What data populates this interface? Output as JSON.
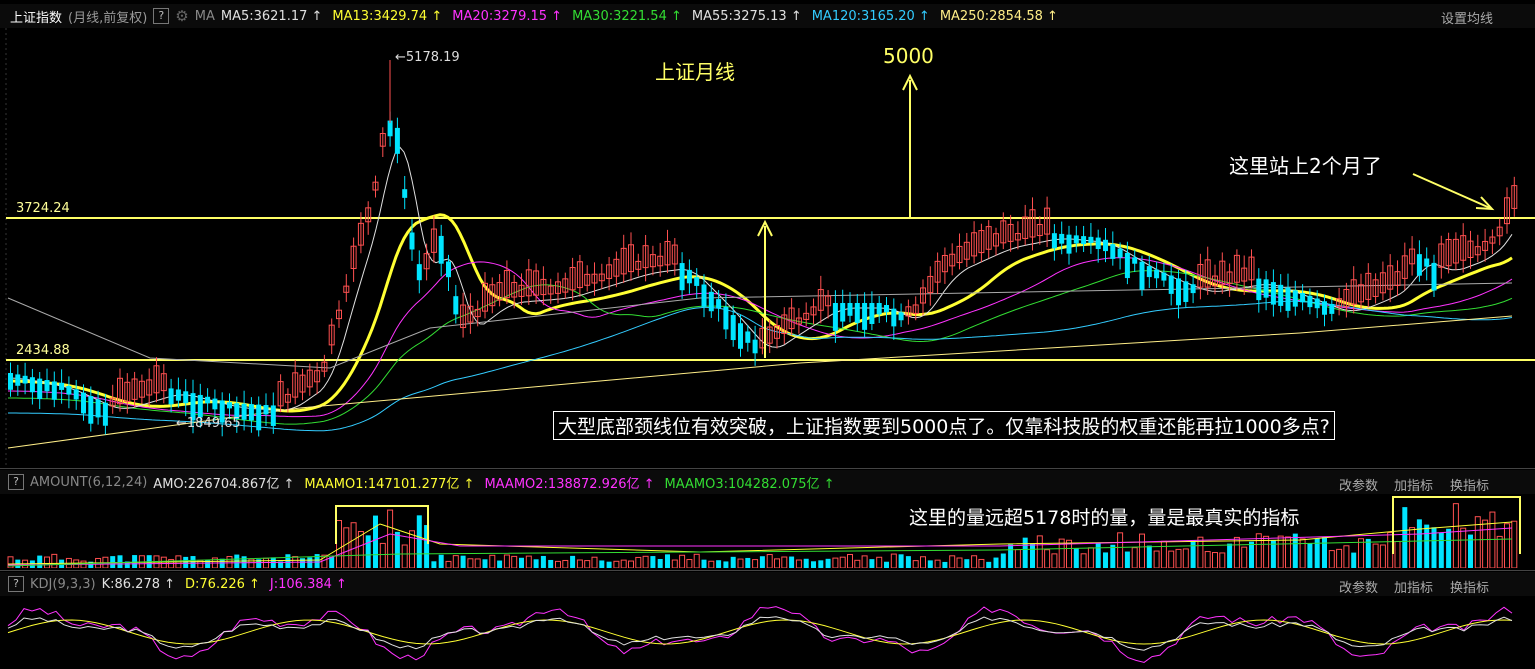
{
  "header": {
    "title": "上证指数",
    "subtitle": "(月线,前复权)",
    "help": "?",
    "ma_label": "MA",
    "indicators": [
      {
        "text": "MA5:3621.17",
        "color": "#e0e0e0"
      },
      {
        "text": "MA13:3429.74",
        "color": "#ffff33"
      },
      {
        "text": "MA20:3279.15",
        "color": "#ff33ff"
      },
      {
        "text": "MA30:3221.54",
        "color": "#33dd33"
      },
      {
        "text": "MA55:3275.13",
        "color": "#e0e0e0"
      },
      {
        "text": "MA120:3165.20",
        "color": "#33ccff"
      },
      {
        "text": "MA250:2854.58",
        "color": "#ffee88"
      }
    ],
    "arrow": "↑",
    "settings": "设置均线"
  },
  "main": {
    "levels": {
      "top": "3724.24",
      "bottom": "2434.88"
    },
    "peak_label": "5178.19",
    "low_label": "1849.65",
    "title_annot": "上证月线",
    "target_annot": "5000",
    "hold_annot": "这里站上2个月了",
    "main_annot": "大型底部颈线位有效突破，上证指数要到5000点了。仅靠科技股的权重还能再拉1000多点?",
    "arrow_left": "←"
  },
  "amount": {
    "help": "?",
    "name": "AMOUNT(6,12,24)",
    "indicators": [
      {
        "text": "AMO:226704.867亿",
        "color": "#e0e0e0"
      },
      {
        "text": "MAAMO1:147101.277亿",
        "color": "#ffff33"
      },
      {
        "text": "MAAMO2:138872.926亿",
        "color": "#ff33ff"
      },
      {
        "text": "MAAMO3:104282.075亿",
        "color": "#33dd33"
      }
    ],
    "annot": "这里的量远超5178时的量，量是最真实的指标"
  },
  "kdj": {
    "help": "?",
    "name": "KDJ(9,3,3)",
    "indicators": [
      {
        "text": "K:86.278",
        "color": "#e0e0e0"
      },
      {
        "text": "D:76.226",
        "color": "#ffff33"
      },
      {
        "text": "J:106.384",
        "color": "#ff33ff"
      }
    ]
  },
  "panel_buttons": {
    "params": "改参数",
    "add": "加指标",
    "swap": "换指标"
  },
  "colors": {
    "up": "#ff5050",
    "down": "#00e5ff",
    "ma": "#ffff33",
    "level": "#ffff66"
  }
}
